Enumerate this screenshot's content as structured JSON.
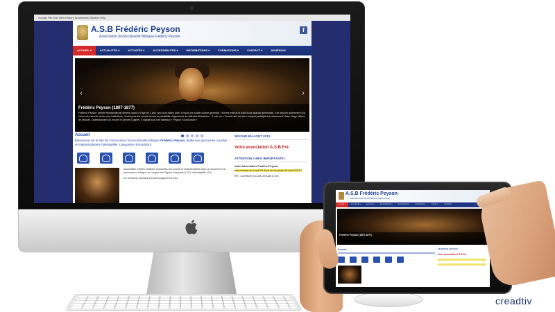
{
  "desktop": {
    "menubar": "Google  File  Edit  View  History  Bookmarks  Window  Help",
    "site": {
      "title": "A.S.B Frédéric Peyson",
      "subtitle": "Association Socioculturelle Bilingue Frédéric Peyson",
      "nav": [
        "ACCUEIL ▾",
        "ACTUALITÉS ▾",
        "ACTIVITÉS ▾",
        "ACCESSIBILITÉS ▾",
        "INFORMATIONS ▾",
        "FORMATIONS ▾",
        "CONTACT ▾",
        "ADHÉSION"
      ],
      "slider": {
        "caption_title": "Frédéric Peyson (1807-1877)",
        "caption_text": "Frédéric Peyson, peintre Montpelliérain devenu sourd à l'âge de 2 ans, issu d'un milieu aisé, il reçoit une solide culture générale. Homme instruit et doté d'une grande générosité, il se dévoue activement à la cause des sourds, fonde des institutions, il crée pour les sourds-muets la possibilité d'apprendre la méthode libératrice... Il crée un « Comité des sourds » auquel participèrent notamment Victor Hugo, Alfred de Musset, Chateaubriand ou encore le peintre Cogniet. Il signait tous ses tableaux « Peyson Sourd-Muet »"
      },
      "content": {
        "heading": "Accueil",
        "welcome_pre": "Bienvenue sur le site de l'Association Socioculturelle Bilingue ",
        "welcome_name": "Frédéric Peyson,",
        "welcome_post": " dédié aux personnes sourdes et malentendantes (Montpellier, Languedoc-Roussillon).",
        "body_text_1": "Association d'aides multiples proposées aux sourds et malentendants avec un accueil et une permanence bilingue en Langue des Signes Française (LSF), à Montpellier (34).",
        "body_text_2": "De nombreux domaines d'accompagnement pour"
      },
      "sidebar": {
        "heading_1": "SÉJOUR EN AOÛT 2013",
        "red_line": "Votre association A.S.B Fré",
        "heading_2": "ATTENTION ! INFO IMPORTANTE !",
        "text_1": "Votre Association Frédéric Peyson,",
        "text_2": "sera fermée du Lundi 12 Août au Vendredi 16 Août 2013 !",
        "text_3": "RÉ - ouverture le Lundi 19 Août à 10h"
      }
    }
  },
  "tablet": {
    "title": "A.S.B Frédéric Peyson",
    "subtitle": "Association Socioculturelle Bilingue Frédéric Peyson",
    "caption_title": "Frédéric Peyson (1807-1877)",
    "heading": "Accueil",
    "side_heading": "SÉJOUR EN AOÛT 2013",
    "side_red": "Votre association A.S.B Fré"
  },
  "brand": "creadtiv"
}
